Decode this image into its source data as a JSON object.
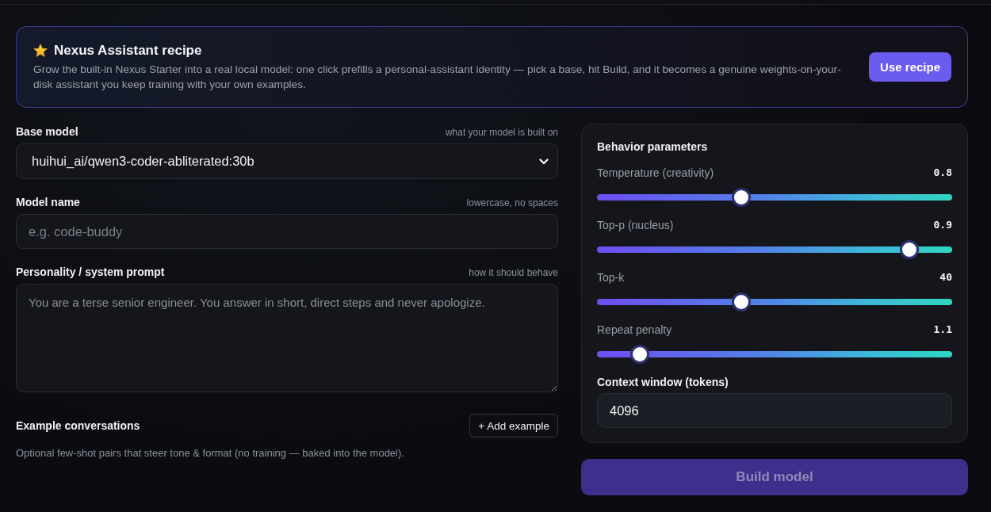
{
  "recipe": {
    "title": "Nexus Assistant recipe",
    "description": "Grow the built-in Nexus Starter into a real local model: one click prefills a personal-assistant identity — pick a base, hit Build, and it becomes a genuine weights-on-your-disk assistant you keep training with your own examples.",
    "button": "Use recipe"
  },
  "form": {
    "base_model": {
      "label": "Base model",
      "hint": "what your model is built on",
      "value": "huihui_ai/qwen3-coder-abliterated:30b"
    },
    "model_name": {
      "label": "Model name",
      "hint": "lowercase, no spaces",
      "placeholder": "e.g. code-buddy"
    },
    "system_prompt": {
      "label": "Personality / system prompt",
      "hint": "how it should behave",
      "placeholder": "You are a terse senior engineer. You answer in short, direct steps and never apologize."
    },
    "examples": {
      "title": "Example conversations",
      "button": "+ Add example",
      "description": "Optional few-shot pairs that steer tone & format (no training — baked into the model)."
    }
  },
  "behavior": {
    "title": "Behavior parameters",
    "sliders": [
      {
        "label": "Temperature (creativity)",
        "reading": "0.8",
        "level": 0.4
      },
      {
        "label": "Top-p (nucleus)",
        "reading": "0.9",
        "level": 0.9
      },
      {
        "label": "Top-k",
        "reading": "40",
        "level": 0.4
      },
      {
        "label": "Repeat penalty",
        "reading": "1.1",
        "level": 0.1
      }
    ],
    "context": {
      "label": "Context window (tokens)",
      "value": "4096"
    }
  },
  "build_button": {
    "label": "Build model",
    "disabled": true
  }
}
